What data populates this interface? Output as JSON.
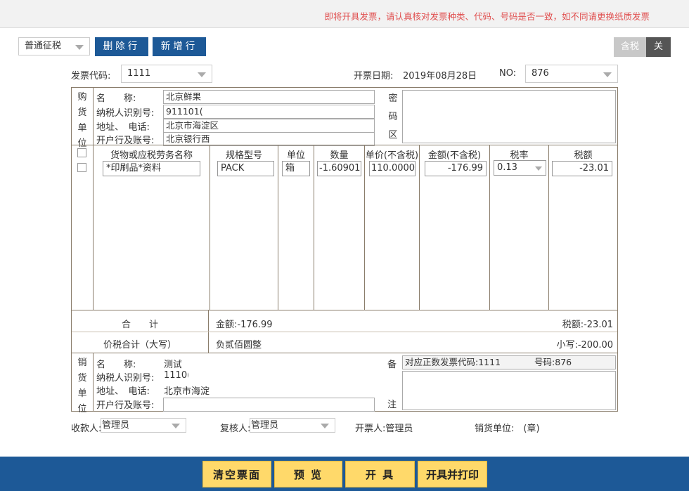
{
  "notice": "即将开具发票，请认真核对发票种类、代码、号码是否一致，如不同请更换纸质发票",
  "toolbar": {
    "tax_type": "普通征税",
    "delete_row": "删除行",
    "add_row": "新增行",
    "tax_incl_label": "含税",
    "tax_toggle_state": "关"
  },
  "header": {
    "code_label": "发票代码:",
    "code_value": "1111",
    "date_label": "开票日期:",
    "date_value": "2019年08月28日",
    "no_label": "NO:",
    "no_value": "876"
  },
  "buyer": {
    "side_label": [
      "购",
      "货",
      "单",
      "位"
    ],
    "name_label": "名　　称:",
    "name_value": "北京鲜果",
    "taxid_label": "纳税人识别号:",
    "taxid_value": "911101(",
    "addr_label": "地址、　电话:",
    "addr_value": "北京市海淀区",
    "bank_label": "开户行及账号:",
    "bank_value": "北京银行西",
    "cipher_label": [
      "密",
      "码",
      "区"
    ]
  },
  "items": {
    "headers": {
      "name": "货物或应税劳务名称",
      "spec": "规格型号",
      "unit": "单位",
      "qty": "数量",
      "price": "单价(不含税)",
      "amount": "金额(不含税)",
      "rate": "税率",
      "tax": "税额"
    },
    "rows": [
      {
        "name": "*印刷品*资料",
        "spec": "PACK",
        "unit": "箱",
        "qty": "-1.60901",
        "price": "110.0000",
        "amount": "-176.99",
        "rate": "0.13",
        "tax": "-23.01"
      }
    ]
  },
  "totals": {
    "sum_label": "合　　计",
    "amount": "金额:-176.99",
    "tax": "税额:-23.01",
    "grand_label": "价税合计（大写）",
    "grand_words": "负贰佰圆整",
    "grand_small": "小写:-200.00"
  },
  "seller": {
    "side_label": [
      "销",
      "货",
      "单",
      "位"
    ],
    "name_label": "名　　称:",
    "name_value": "测试",
    "taxid_label": "纳税人识别号:",
    "taxid_value": "1110(",
    "addr_label": "地址、　电话:",
    "addr_value": "北京市海淀",
    "bank_label": "开户行及账号:",
    "bank_value": "",
    "remark_top": "备",
    "remark_bottom": "注",
    "remark_code_text": "对应正数发票代码:1111",
    "remark_no_text": "号码:876"
  },
  "footer": {
    "payee_label": "收款人:",
    "payee_value": "管理员",
    "reviewer_label": "复核人:",
    "reviewer_value": "管理员",
    "issuer_text": "开票人:管理员",
    "seller_seal": "销货单位:　(章)"
  },
  "actions": {
    "clear": "清空票面",
    "preview": "预 览",
    "issue": "开 具",
    "issue_print": "开具并打印"
  }
}
